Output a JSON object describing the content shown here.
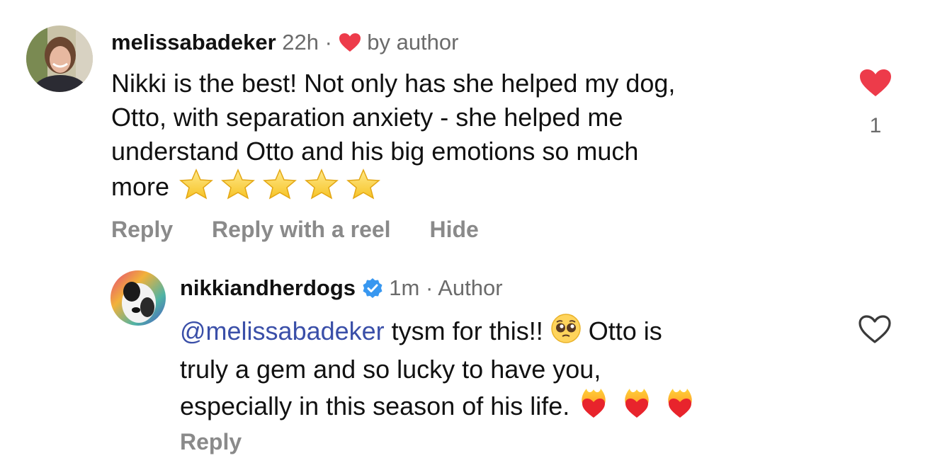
{
  "comments": [
    {
      "username": "melissabadeker",
      "time": "22h",
      "separator": "·",
      "badge_text": "by author",
      "badge_icon": "heart-filled-icon",
      "body_lines": [
        "Nikki is the best! Not only has she helped my dog,",
        "Otto, with separation anxiety - she helped me",
        "understand Otto and his big emotions so much",
        "more"
      ],
      "trailing_emoji": "star-emoji",
      "trailing_emoji_count": 5,
      "actions": [
        "Reply",
        "Reply with a reel",
        "Hide"
      ],
      "liked": true,
      "like_count": "1",
      "like_color": "#ed3b4a"
    }
  ],
  "reply": {
    "username": "nikkiandherdogs",
    "verified": true,
    "time": "1m",
    "separator": "·",
    "role": "Author",
    "mention": "@melissabadeker",
    "line1_rest": " tysm for this!! ",
    "line1_emoji": "pleading-face-emoji",
    "line1_after": " Otto is",
    "line2": "truly a gem and so lucky to have you,",
    "line3": "especially in this season of his life. ",
    "line3_emoji": "heart-on-fire-emoji",
    "line3_emoji_count": 3,
    "actions": [
      "Reply"
    ],
    "liked": false
  },
  "colors": {
    "mention": "#3a4fa8",
    "verified": "#3897f0",
    "muted": "#6b6b6b",
    "action": "#8a8a8a"
  }
}
